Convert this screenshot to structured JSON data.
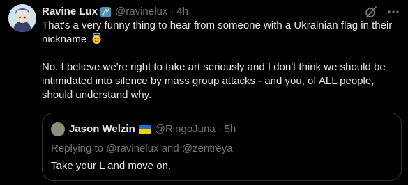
{
  "tweet": {
    "author": {
      "display_name": "Ravine Lux",
      "badge_icon": "badge-icon",
      "handle": "@ravinelux",
      "separator": "·",
      "time": "4h"
    },
    "header_icons": [
      "grok-icon",
      "more-icon"
    ],
    "body": {
      "paragraph1": "That's a very funny thing to hear from someone with a Ukrainian flag in their nickname",
      "emoji": "smiling-face-with-halo-emoji",
      "paragraph2": "No. I believe we're right to take art seriously and I don't think we should be intimidated into silence by mass group attacks - and you, of ALL people, should understand why."
    },
    "quote": {
      "display_name": "Jason Welzin",
      "flag": "ukraine-flag",
      "handle": "@RingoJuna",
      "separator": "·",
      "time": "5h",
      "replying_prefix": "Replying to",
      "mention1": "@ravinelux",
      "conjunction": "and",
      "mention2": "@zentreya",
      "text": "Take your L and move on."
    }
  },
  "colors": {
    "background": "#000000",
    "text_primary": "#e7e9ea",
    "text_secondary": "#71767b",
    "border": "#2f3336"
  }
}
